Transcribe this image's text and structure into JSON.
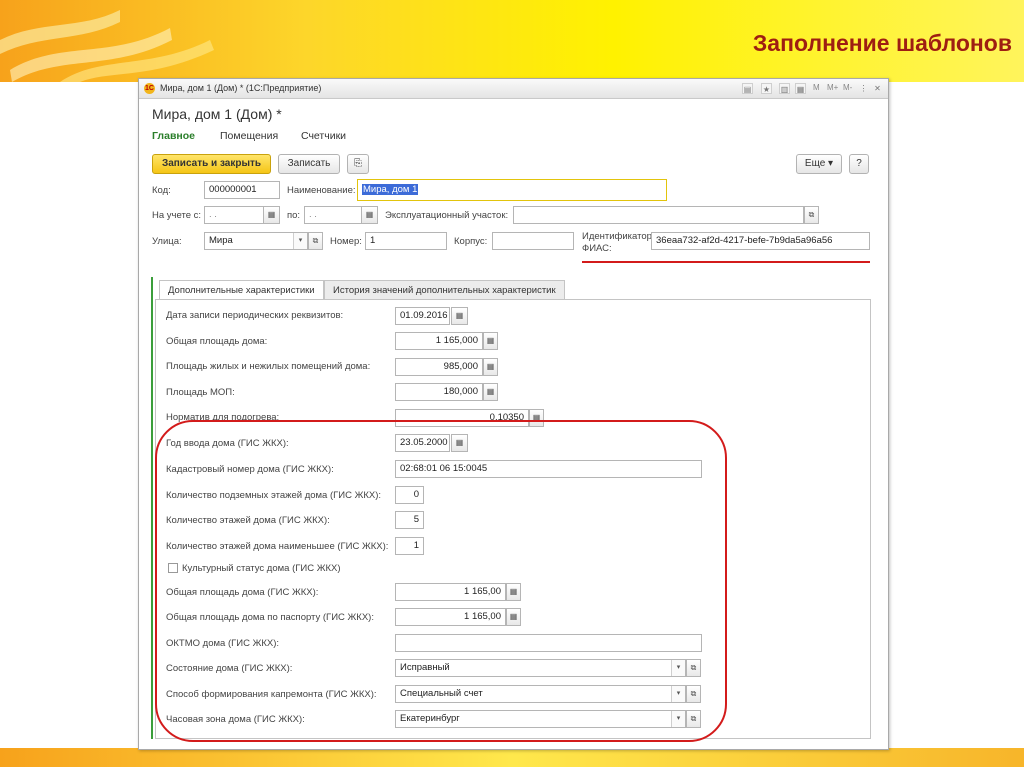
{
  "slide": {
    "title": "Заполнение шаблонов"
  },
  "window": {
    "title": "Мира, дом 1 (Дом) * (1С:Предприятие)"
  },
  "titlebar_buttons": {
    "m": "M",
    "m_plus": "M+",
    "m_minus": "M-"
  },
  "form": {
    "title": "Мира, дом 1 (Дом) *",
    "tabs": [
      "Главное",
      "Помещения",
      "Счетчики"
    ],
    "toolbar": {
      "save_close": "Записать и закрыть",
      "save": "Записать",
      "more": "Еще",
      "help": "?"
    }
  },
  "fields": {
    "code": {
      "label": "Код:",
      "value": "000000001"
    },
    "name": {
      "label": "Наименование:",
      "value": "Мира, дом 1"
    },
    "registered_from": {
      "label": "На учете с:",
      "value": ". ."
    },
    "registered_to": {
      "label": "по:",
      "value": ". ."
    },
    "operation_area": {
      "label": "Эксплуатационный участок:",
      "value": ""
    },
    "street": {
      "label": "Улица:",
      "value": "Мира"
    },
    "number": {
      "label": "Номер:",
      "value": "1"
    },
    "building": {
      "label": "Корпус:",
      "value": ""
    },
    "fias": {
      "label_line1": "Идентификатор",
      "label_line2": "ФИАС:",
      "value": "36eaa732-af2d-4217-befe-7b9da5a96a56"
    }
  },
  "inner_tabs": [
    "Дополнительные характеристики",
    "История значений дополнительных характеристик"
  ],
  "characteristics": [
    {
      "label": "Дата записи периодических реквизитов:",
      "value": "01.09.2016"
    },
    {
      "label": "Общая площадь дома:",
      "value": "1 165,000"
    },
    {
      "label": "Площадь жилых и нежилых помещений дома:",
      "value": "985,000"
    },
    {
      "label": "Площадь МОП:",
      "value": "180,000"
    },
    {
      "label": "Норматив для подогрева:",
      "value": "0,10350"
    },
    {
      "label": "Год ввода дома (ГИС ЖКХ):",
      "value": "23.05.2000"
    },
    {
      "label": "Кадастровый номер дома (ГИС ЖКХ):",
      "value": "02:68:01 06 15:0045"
    },
    {
      "label": "Количество подземных этажей дома (ГИС ЖКХ):",
      "value": "0"
    },
    {
      "label": "Количество этажей дома (ГИС ЖКХ):",
      "value": "5"
    },
    {
      "label": "Количество этажей дома наименьшее (ГИС ЖКХ):",
      "value": "1"
    },
    {
      "label": "Культурный статус дома (ГИС ЖКХ)",
      "value": ""
    },
    {
      "label": "Общая площадь дома (ГИС ЖКХ):",
      "value": "1 165,00"
    },
    {
      "label": "Общая площадь дома по паспорту (ГИС ЖКХ):",
      "value": "1 165,00"
    },
    {
      "label": "ОКТМО дома (ГИС ЖКХ):",
      "value": ""
    },
    {
      "label": "Состояние дома (ГИС ЖКХ):",
      "value": "Исправный"
    },
    {
      "label": "Способ формирования капремонта (ГИС ЖКХ):",
      "value": "Специальный счет"
    },
    {
      "label": "Часовая зона дома (ГИС ЖКХ):",
      "value": "Екатеринбург"
    }
  ],
  "icons": {
    "app_logo": "1c-logo-icon",
    "calendar": "calendar-icon",
    "calculator": "calculator-icon",
    "dropdown": "chevron-down-icon",
    "open": "open-form-icon"
  },
  "colors": {
    "accent_green": "#2a7e2a",
    "primary_button": "#f5c516",
    "annotation_red": "#d31b1b"
  }
}
